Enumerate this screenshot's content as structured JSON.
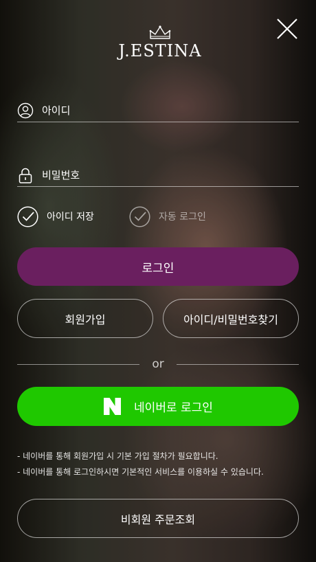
{
  "brand": {
    "logo_text": "J.ESTINA"
  },
  "header": {
    "close_icon": "close-icon"
  },
  "login_form": {
    "id_field": {
      "label": "아이디",
      "icon": "user-icon"
    },
    "password_field": {
      "label": "비밀번호",
      "icon": "lock-icon"
    },
    "save_id": {
      "label": "아이디 저장",
      "checked": true
    },
    "auto_login": {
      "label": "자동 로그인",
      "checked": false
    },
    "login_button": "로그인"
  },
  "actions": {
    "join": "회원가입",
    "find": "아이디/비밀번호찾기"
  },
  "divider_text": "or",
  "naver": {
    "label": "네이버로 로그인",
    "icon": "naver-icon"
  },
  "notes": [
    "- 네이버를 통해 회원가입 시 기본 가입 절차가 필요합니다.",
    "- 네이버를 통해 로그인하시면 기본적인 서비스를 이용하실 수 있습니다."
  ],
  "guest_order": "비회원 주문조회",
  "colors": {
    "login_button": "#6a1f5f",
    "naver_button": "#1fc800"
  }
}
